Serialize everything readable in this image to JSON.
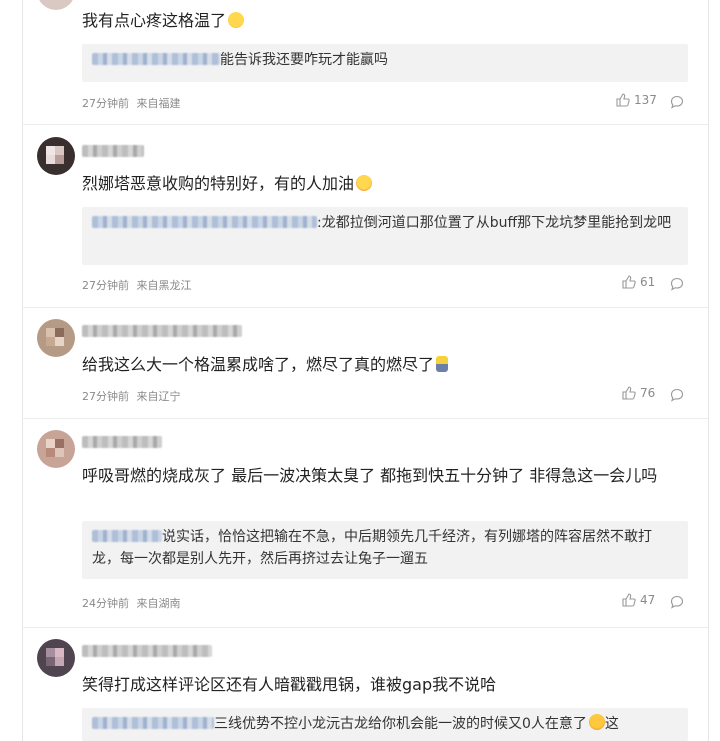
{
  "comments": [
    {
      "text": "我有点心疼这格温了",
      "reply_text": "能告诉我还要咋玩才能赢吗",
      "time": "27分钟前",
      "location": "来自福建",
      "likes": "137",
      "emoji_icon": "grimace-emoji-icon"
    },
    {
      "text": "烈娜塔恶意收购的特别好，有的人加油",
      "reply_text": ":龙都拉倒河道口那位置了从buff那下龙坑梦里能抢到龙吧",
      "time": "27分钟前",
      "location": "来自黑龙江",
      "likes": "61",
      "emoji_icon": "cheer-emoji-icon"
    },
    {
      "text": "给我这么大一个格温累成啥了，燃尽了真的燃尽了",
      "time": "27分钟前",
      "location": "来自辽宁",
      "likes": "76",
      "emoji_icon": "burnt-out-emoji-icon"
    },
    {
      "text": "呼吸哥燃的烧成灰了 最后一波决策太臭了 都拖到快五十分钟了 非得急这一会儿吗",
      "reply_text": "说实话，恰恰这把输在不急，中后期领先几千经济，有列娜塔的阵容居然不敢打龙，每一次都是别人先开，然后再挤过去让兔子一遛五",
      "time": "24分钟前",
      "location": "来自湖南",
      "likes": "47"
    },
    {
      "text": "笑得打成这样评论区还有人暗戳戳甩锅，谁被gap我不说哈",
      "reply_text": "三线优势不控小龙沅古龙给你机会能一波的时候又0人在意了",
      "reply_tail": "这",
      "emoji_icon": "shrug-emoji-icon"
    }
  ],
  "colors": {
    "text": "#222222",
    "meta": "#8a8a8a",
    "reply_bg": "#f2f2f2",
    "divider": "#ececec"
  }
}
